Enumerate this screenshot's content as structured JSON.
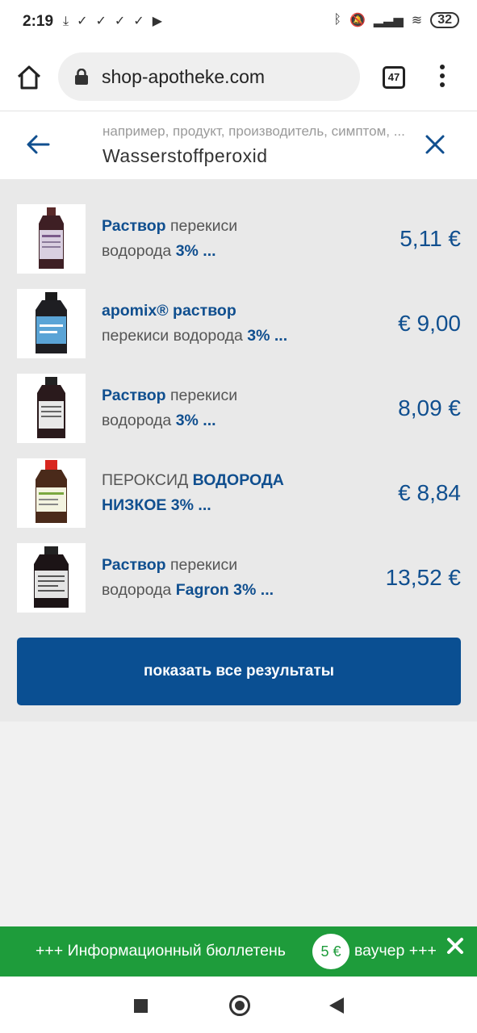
{
  "status_bar": {
    "time": "2:19",
    "battery": "32",
    "left_icons": [
      "download-icon",
      "check-icon",
      "check-icon",
      "check-icon",
      "check-icon",
      "youtube-icon"
    ],
    "right_icons": [
      "bluetooth-icon",
      "mute-icon",
      "signal-icon",
      "wifi-icon"
    ]
  },
  "browser": {
    "url": "shop-apotheke.com",
    "tab_count": "47"
  },
  "search": {
    "placeholder": "например, продукт, производитель, симптом, ...",
    "value": "Wasserstoffperoxid"
  },
  "results": [
    {
      "name_parts": [
        {
          "text": "Раствор",
          "bold": true
        },
        {
          "text": " перекиси водорода ",
          "bold": false
        },
        {
          "text": "3% ...",
          "bold": true
        }
      ],
      "price": "5,11 €"
    },
    {
      "name_parts": [
        {
          "text": "apomix® раствор",
          "bold": true
        },
        {
          "text": " перекиси водорода ",
          "bold": false
        },
        {
          "text": "3% ...",
          "bold": true
        }
      ],
      "price": "€ 9,00"
    },
    {
      "name_parts": [
        {
          "text": "Раствор",
          "bold": true
        },
        {
          "text": " перекиси водорода ",
          "bold": false
        },
        {
          "text": "3% ...",
          "bold": true
        }
      ],
      "price": "8,09 €"
    },
    {
      "name_parts": [
        {
          "text": "ПЕРОКСИД ",
          "bold": false
        },
        {
          "text": "ВОДОРОДА НИЗКОЕ 3% ...",
          "bold": true
        }
      ],
      "price": "€ 8,84"
    },
    {
      "name_parts": [
        {
          "text": "Раствор",
          "bold": true
        },
        {
          "text": " перекиси водорода ",
          "bold": false
        },
        {
          "text": "Fagron 3% ...",
          "bold": true
        }
      ],
      "price": "13,52 €"
    }
  ],
  "show_all_label": "показать все результаты",
  "banner": {
    "text_before": "+++ Информационный бюллетень",
    "voucher": "5 €",
    "text_after": "ваучер +++"
  },
  "colors": {
    "accent": "#104f8f",
    "button": "#0a4f92",
    "banner": "#1e9c3b"
  }
}
